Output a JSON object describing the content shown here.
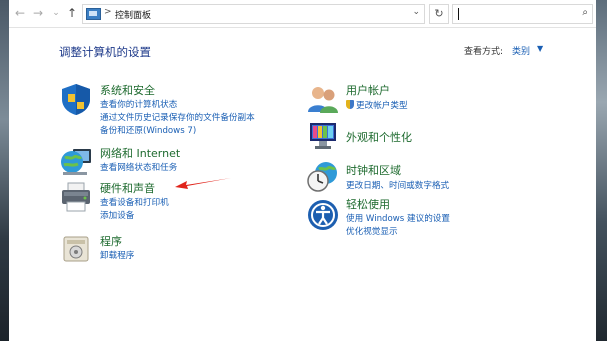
{
  "nav": {
    "back": "←",
    "forward": "→",
    "recent": "⌄",
    "up": "↑"
  },
  "address": {
    "separator": ">",
    "path": "控制面板",
    "dropdown": "⌄",
    "refresh": "↻"
  },
  "search": {
    "placeholder": "",
    "icon": "⌕"
  },
  "header": {
    "title": "调整计算机的设置",
    "view_by_label": "查看方式:",
    "view_by_value": "类别",
    "view_by_caret": "▼"
  },
  "categories_left": [
    {
      "title": "系统和安全",
      "links": [
        "查看你的计算机状态",
        "通过文件历史记录保存你的文件备份副本",
        "备份和还原(Windows 7)"
      ]
    },
    {
      "title": "网络和 Internet",
      "links": [
        "查看网络状态和任务"
      ]
    },
    {
      "title": "硬件和声音",
      "links": [
        "查看设备和打印机",
        "添加设备"
      ]
    },
    {
      "title": "程序",
      "links": [
        "卸载程序"
      ]
    }
  ],
  "categories_right": [
    {
      "title": "用户帐户",
      "links": [
        "更改帐户类型"
      ]
    },
    {
      "title": "外观和个性化",
      "links": []
    },
    {
      "title": "时钟和区域",
      "links": [
        "更改日期、时间或数字格式"
      ]
    },
    {
      "title": "轻松使用",
      "links": [
        "使用 Windows 建议的设置",
        "优化视觉显示"
      ]
    }
  ],
  "annotation": {
    "arrow_color": "#e0241b"
  }
}
